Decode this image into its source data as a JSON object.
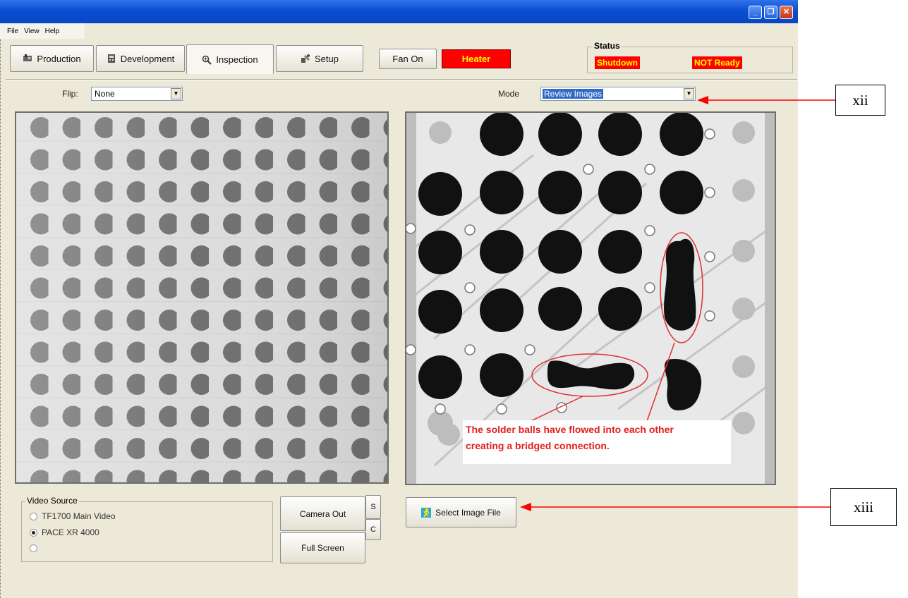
{
  "menu": {
    "items": [
      "File",
      "View",
      "Help"
    ]
  },
  "tabs": [
    {
      "label": "Production",
      "icon": "production-icon"
    },
    {
      "label": "Development",
      "icon": "development-icon"
    },
    {
      "label": "Inspection",
      "icon": "magnifier-icon",
      "active": true
    },
    {
      "label": "Setup",
      "icon": "setup-icon"
    }
  ],
  "controls": {
    "fan_label": "Fan On",
    "heater_label": "Heater"
  },
  "status": {
    "title": "Status",
    "state1": "Shutdown",
    "state2": "NOT Ready"
  },
  "flip": {
    "label": "Flip:",
    "value": "None"
  },
  "mode": {
    "label": "Mode",
    "value": "Review Images"
  },
  "annotation_text": [
    "The solder balls have flowed into each other",
    "creating a bridged connection."
  ],
  "video_source": {
    "title": "Video Source",
    "options": [
      "TF1700 Main Video",
      "PACE XR 4000",
      ""
    ],
    "selected_index": 1
  },
  "buttons": {
    "camera_out": "Camera Out",
    "full_screen": "Full Screen",
    "side_s": "S",
    "side_c": "C",
    "select_image": "Select Image File"
  },
  "callouts": {
    "mode": "xii",
    "select": "xiii"
  },
  "colors": {
    "accent_red": "#ff0000",
    "status_text": "#ffff00",
    "titlebar": "#0a4fd2",
    "window_bg": "#ece9d8"
  }
}
